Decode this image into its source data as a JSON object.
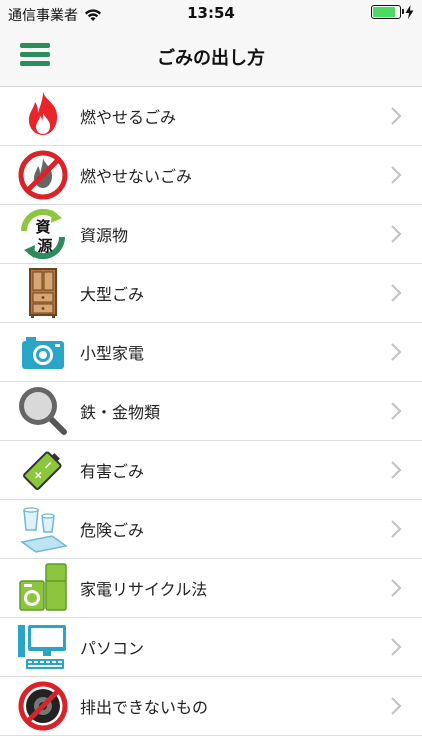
{
  "status_bar": {
    "carrier": "通信事業者",
    "time": "13:54",
    "battery_level": 0.85
  },
  "nav": {
    "title": "ごみの出し方",
    "menu_icon": "hamburger-menu-icon"
  },
  "categories": [
    {
      "label": "燃やせるごみ",
      "icon": "flame-icon"
    },
    {
      "label": "燃やせないごみ",
      "icon": "no-burn-icon"
    },
    {
      "label": "資源物",
      "icon": "recycle-resource-icon"
    },
    {
      "label": "大型ごみ",
      "icon": "cabinet-icon"
    },
    {
      "label": "小型家電",
      "icon": "camera-icon"
    },
    {
      "label": "鉄・金物類",
      "icon": "frying-pan-icon"
    },
    {
      "label": "有害ごみ",
      "icon": "battery-icon"
    },
    {
      "label": "危険ごみ",
      "icon": "broken-glass-icon"
    },
    {
      "label": "家電リサイクル法",
      "icon": "appliances-icon"
    },
    {
      "label": "パソコン",
      "icon": "computer-icon"
    },
    {
      "label": "排出できないもの",
      "icon": "prohibited-tire-icon"
    }
  ],
  "colors": {
    "accent": "#2e8b5e",
    "flame": "#e8252a",
    "prohibit": "#d8232a",
    "green": "#8cc63f",
    "teal": "#2aa5c8"
  }
}
